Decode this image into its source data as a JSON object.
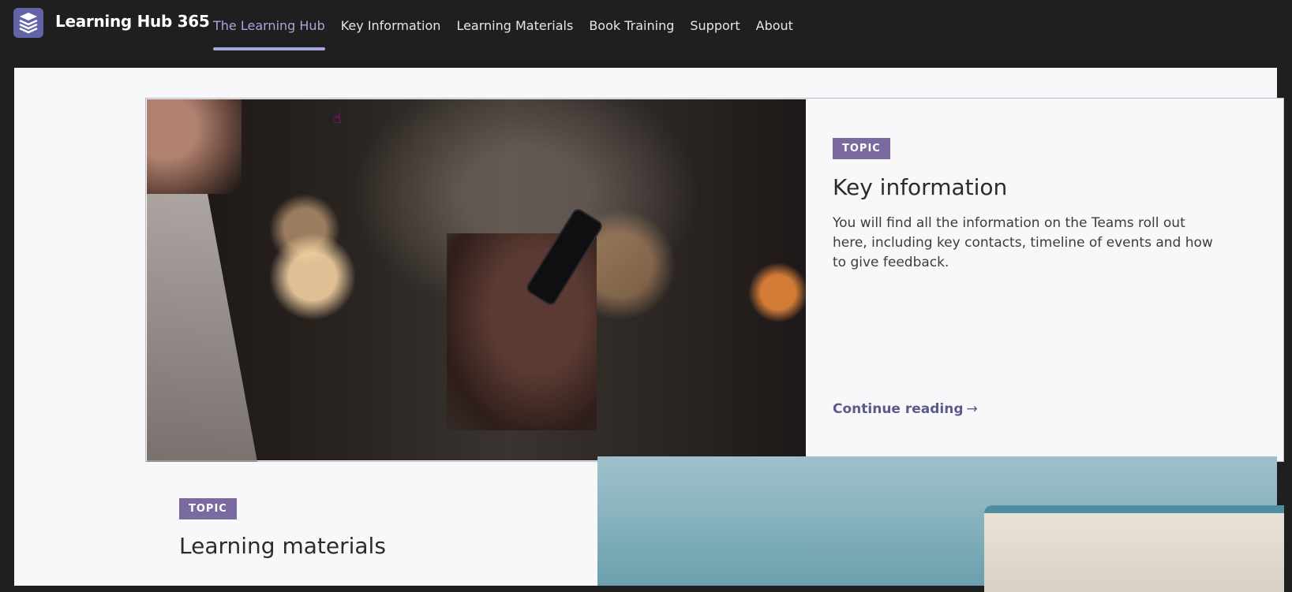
{
  "app": {
    "title": "Learning Hub 365",
    "logo_icon": "stack-books-icon"
  },
  "nav": {
    "tabs": [
      {
        "label": "The Learning Hub",
        "active": true
      },
      {
        "label": "Key Information",
        "active": false
      },
      {
        "label": "Learning Materials",
        "active": false
      },
      {
        "label": "Book Training",
        "active": false
      },
      {
        "label": "Support",
        "active": false
      },
      {
        "label": "About",
        "active": false
      }
    ]
  },
  "cards": [
    {
      "badge": "TOPIC",
      "title": "Key information",
      "description": "You will find all the information on the Teams roll out here, including key contacts, timeline of events and how to give feedback.",
      "link": "Continue reading",
      "image": "person-using-smartphone-photo"
    },
    {
      "badge": "TOPIC",
      "title": "Learning materials",
      "image": "books-on-blue-background-photo"
    }
  ],
  "colors": {
    "accent": "#a6a7dc",
    "badge": "#7a6aa0",
    "link": "#5b5a88",
    "topbar": "#1f1f1f"
  }
}
